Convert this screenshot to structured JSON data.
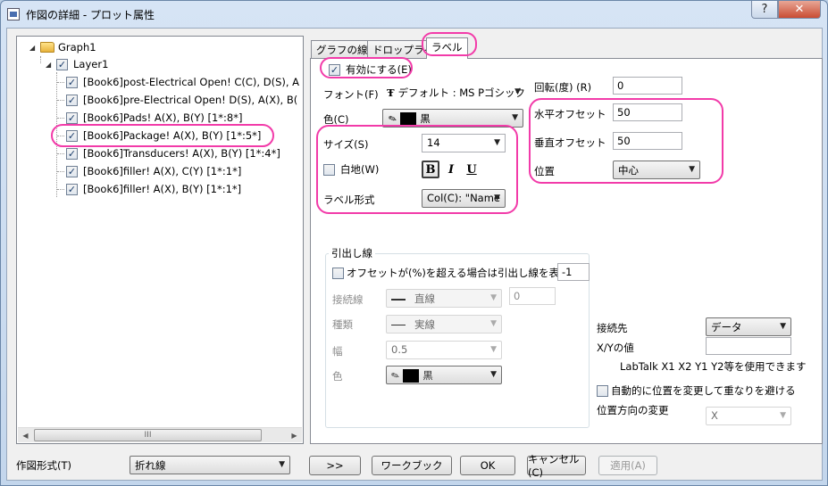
{
  "window": {
    "title": "作図の詳細 - プロット属性",
    "help_label": "?",
    "close_label": "✕"
  },
  "tree": {
    "root": "Graph1",
    "layer": "Layer1",
    "items": [
      "[Book6]post-Electrical Open! C(C), D(S), A",
      "[Book6]pre-Electrical Open! D(S), A(X), B(",
      "[Book6]Pads! A(X), B(Y) [1*:8*]",
      "[Book6]Package! A(X), B(Y) [1*:5*]",
      "[Book6]Transducers! A(X), B(Y) [1*:4*]",
      "[Book6]filler! A(X), C(Y) [1*:1*]",
      "[Book6]filler! A(X), B(Y) [1*:1*]"
    ],
    "scroll_grip": "III"
  },
  "tabs": [
    "グラフの線",
    "ドロップライン",
    "ラベル"
  ],
  "label_tab": {
    "enable_label": "有効にする(E)",
    "font_label": "フォント(F)",
    "font_value": "デフォルト : MS Pゴシック",
    "color_label": "色(C)",
    "color_value": "黒",
    "size_label": "サイズ(S)",
    "size_value": "14",
    "white_bg_label": "白地(W)",
    "bold": "B",
    "italic": "I",
    "underline": "U",
    "label_format_label": "ラベル形式",
    "label_format_value": "Col(C): \"Name",
    "rotation_label": "回転(度) (R)",
    "rotation_value": "0",
    "h_offset_label": "水平オフセット",
    "h_offset_value": "50",
    "v_offset_label": "垂直オフセット",
    "v_offset_value": "50",
    "position_label": "位置",
    "position_value": "中心"
  },
  "leader": {
    "group_title": "引出し線",
    "offset_check_label": "オフセットが(%)を超える場合は引出し線を表示",
    "offset_value": "-1",
    "connector_label": "接続線",
    "connector_value": "直線",
    "connector_num": "0",
    "type_label": "種類",
    "type_value": "実線",
    "width_label": "幅",
    "width_value": "0.5",
    "color_label": "色",
    "color_value": "黒"
  },
  "connection": {
    "target_label": "接続先",
    "target_value": "データ",
    "xy_label": "X/Yの値",
    "xy_value": "",
    "labtalk_hint": "LabTalk X1 X2 Y1 Y2等を使用できます",
    "auto_position_label": "自動的に位置を変更して重なりを避ける",
    "direction_label": "位置方向の変更",
    "direction_value": "X"
  },
  "bottom": {
    "plot_type_label": "作図形式(T)",
    "plot_type_value": "折れ線",
    "more_btn": ">>",
    "workbook_btn": "ワークブック",
    "ok_btn": "OK",
    "cancel_btn": "キャンセル(C)",
    "apply_btn": "適用(A)"
  },
  "colors": {
    "highlight_ring": "#f23ba9",
    "swatch": "#000000"
  }
}
